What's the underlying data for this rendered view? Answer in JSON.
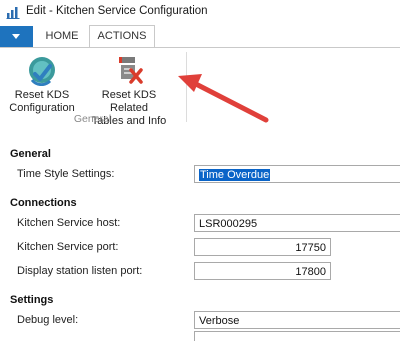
{
  "window": {
    "title": "Edit - Kitchen Service Configuration"
  },
  "ribbon": {
    "file_icon": "caret-down-icon",
    "tabs": [
      "HOME",
      "ACTIONS"
    ],
    "active_tab": "ACTIONS",
    "buttons": [
      {
        "label_line1": "Reset KDS",
        "label_line2": "Configuration",
        "icon": "reset-config-icon"
      },
      {
        "label_line1": "Reset KDS Related",
        "label_line2": "Tables and Info",
        "icon": "reset-tables-icon"
      }
    ],
    "group_label": "General"
  },
  "annotation": {
    "color": "#e0403a"
  },
  "form": {
    "sections": {
      "general": "General",
      "connections": "Connections",
      "settings": "Settings"
    },
    "fields": {
      "time_style": {
        "label": "Time Style Settings:",
        "value": "Time Overdue"
      },
      "host": {
        "label": "Kitchen Service host:",
        "value": "LSR000295"
      },
      "port": {
        "label": "Kitchen Service port:",
        "value": "17750"
      },
      "listen_port": {
        "label": "Display station listen port:",
        "value": "17800"
      },
      "debug": {
        "label": "Debug level:",
        "value": "Verbose"
      }
    }
  },
  "colors": {
    "accent": "#1e73be",
    "selection": "#0a64c8"
  }
}
